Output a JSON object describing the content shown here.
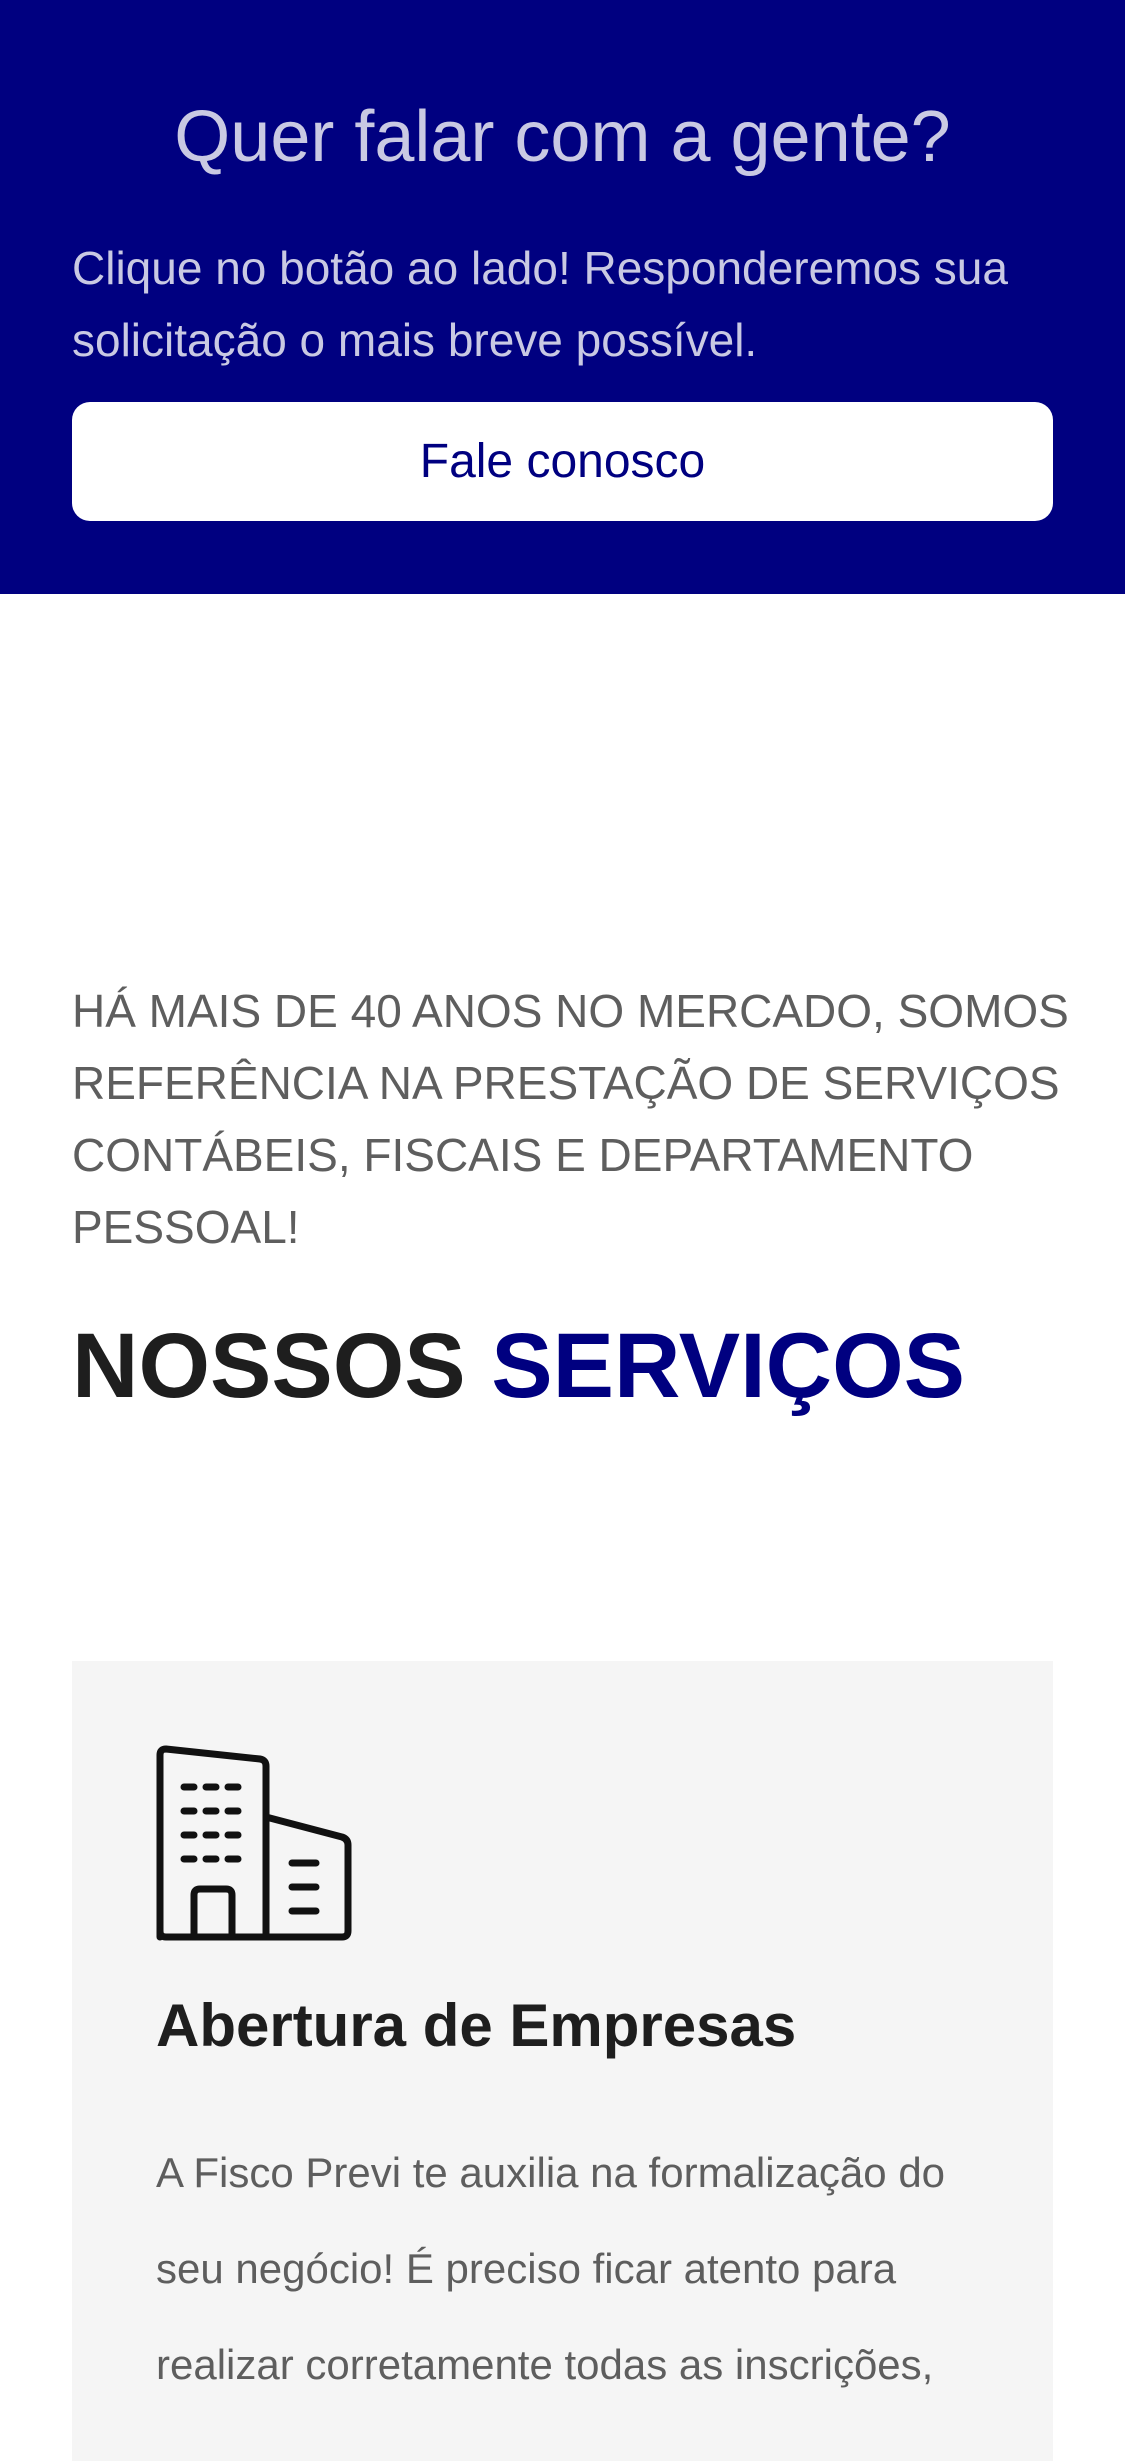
{
  "contact": {
    "title": "Quer falar com a gente?",
    "text": "Clique no botão ao lado! Responderemos sua solicitação o mais breve possível.",
    "button_label": "Fale conosco"
  },
  "intro": {
    "text": "HÁ MAIS DE 40 ANOS NO MERCADO, SOMOS REFERÊNCIA NA PRESTAÇÃO DE SERVIÇOS CONTÁBEIS, FISCAIS E DEPARTAMENTO PESSOAL!"
  },
  "services": {
    "heading_part1": "NOSSOS ",
    "heading_part2": "SERVIÇOS",
    "items": [
      {
        "icon": "building-icon",
        "title": "Abertura de Empresas",
        "description": "A Fisco Previ te auxilia na formalização do seu negócio! É preciso ficar atento para realizar corretamente todas as inscrições,"
      }
    ]
  },
  "colors": {
    "brand_blue": "#000080",
    "banner_text": "#c9c9e3",
    "card_background": "#f5f5f5",
    "heading_dark": "#1e1e1e",
    "body_gray": "#5e5e5e"
  }
}
